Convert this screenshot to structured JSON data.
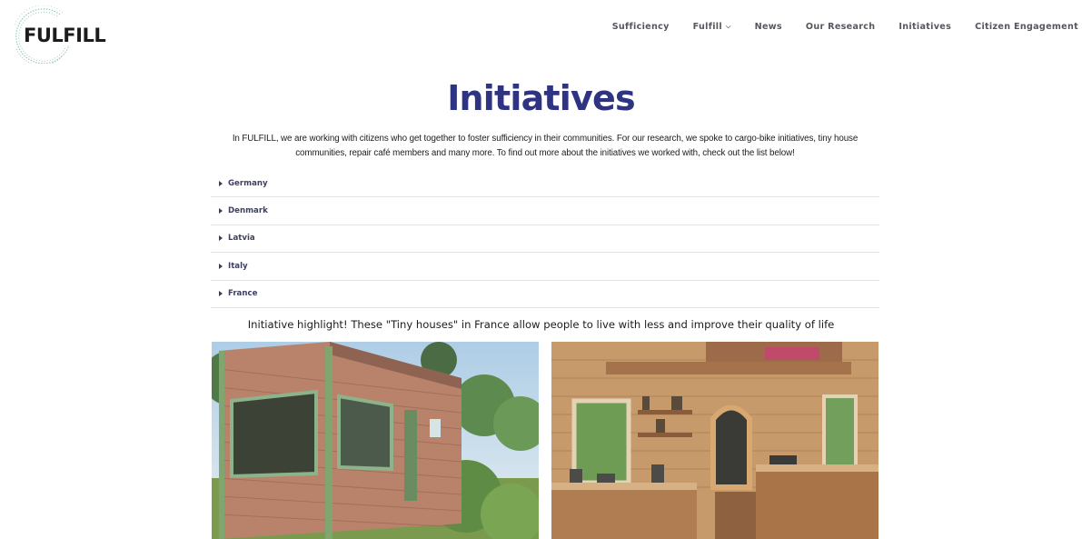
{
  "brand": {
    "name": "FULFILL"
  },
  "nav": {
    "items": [
      {
        "label": "Sufficiency",
        "has_dropdown": false
      },
      {
        "label": "Fulfill",
        "has_dropdown": true
      },
      {
        "label": "News",
        "has_dropdown": false
      },
      {
        "label": "Our Research",
        "has_dropdown": false
      },
      {
        "label": "Initiatives",
        "has_dropdown": false
      },
      {
        "label": "Citizen Engagement",
        "has_dropdown": false
      }
    ]
  },
  "page": {
    "title": "Initiatives",
    "intro": "In FULFILL, we are working with citizens who get together to foster sufficiency in their communities. For our research, we spoke to cargo-bike initiatives, tiny house communities, repair café members and many more. To find out more about the initiatives we worked with, check out the list below!",
    "highlight": "Initiative highlight! These \"Tiny houses\" in France allow people to live with less and improve their quality of life"
  },
  "accordion": {
    "items": [
      {
        "label": "Germany"
      },
      {
        "label": "Denmark"
      },
      {
        "label": "Latvia"
      },
      {
        "label": "Italy"
      },
      {
        "label": "France"
      }
    ]
  },
  "colors": {
    "title": "#2e3382",
    "nav_text": "#55575e",
    "accordion_text": "#3d3f63",
    "logo_ring": "#7fc2a6"
  }
}
